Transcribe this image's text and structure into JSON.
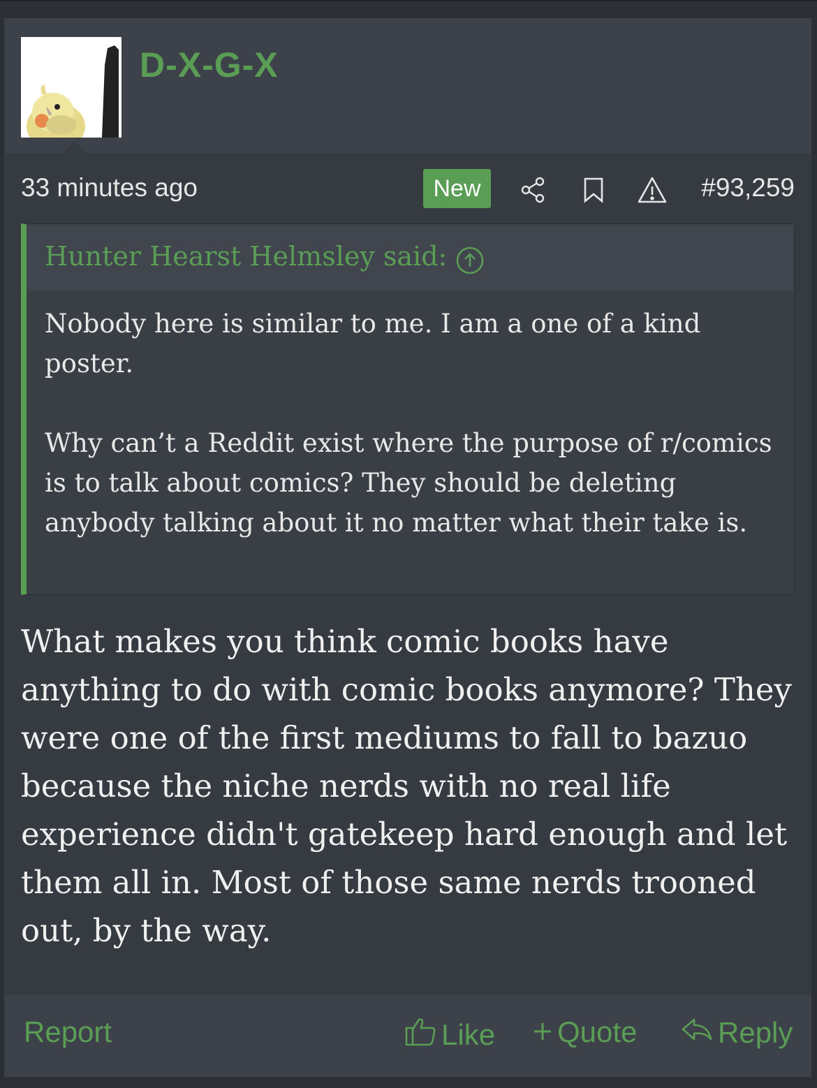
{
  "user": {
    "name": "D-X-G-X"
  },
  "meta": {
    "time": "33 minutes ago",
    "badge": "New",
    "post_number": "#93,259"
  },
  "quote": {
    "author_line": "Hunter Hearst Helmsley said:",
    "paragraphs": [
      "Nobody here is similar to me. I am a one of a kind poster.",
      "Why can’t a Reddit exist where the purpose of r/comics is to talk about comics? They should be deleting anybody talking about it no matter what their take is."
    ]
  },
  "message": "What makes you think comic books have anything to do with comic books anymore? They were one of the first mediums to fall to bazuo because the niche nerds with no real life experience didn't gatekeep hard enough and let them all in. Most of those same nerds trooned out, by the way.",
  "footer": {
    "report": "Report",
    "like": "Like",
    "quote": "Quote",
    "reply": "Reply"
  },
  "colors": {
    "accent": "#5a9e55",
    "background": "#363a41",
    "header": "#3d4149"
  }
}
